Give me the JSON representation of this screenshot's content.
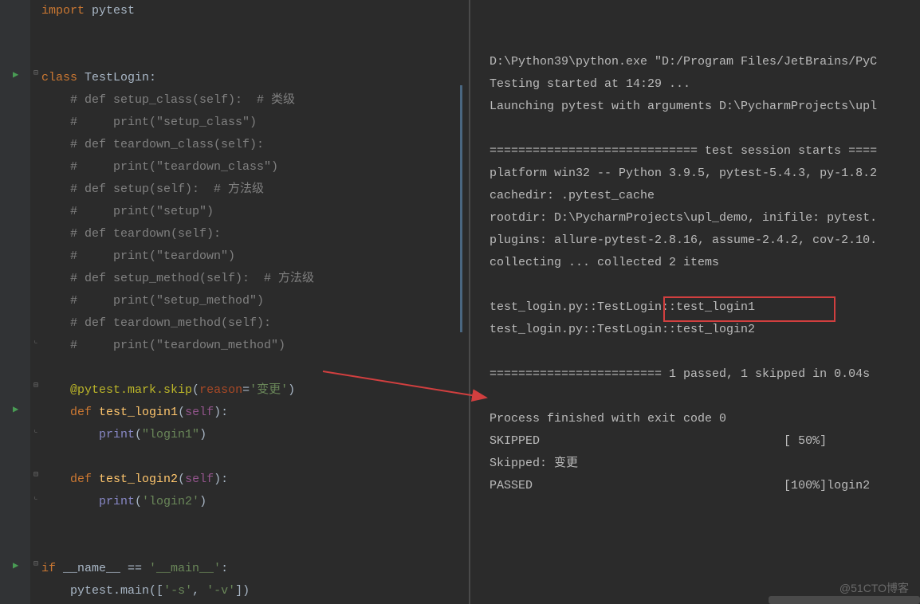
{
  "editor": {
    "lines": [
      {
        "indent": 0,
        "type": "import",
        "tokens": [
          {
            "c": "kw",
            "t": "import "
          },
          {
            "c": "",
            "t": "pytest"
          }
        ]
      },
      {
        "indent": 0,
        "type": "blank"
      },
      {
        "indent": 0,
        "type": "blank"
      },
      {
        "indent": 0,
        "type": "class",
        "run": true,
        "fold": "-",
        "tokens": [
          {
            "c": "kw",
            "t": "class "
          },
          {
            "c": "",
            "t": "TestLogin:"
          }
        ]
      },
      {
        "indent": 1,
        "type": "comment",
        "tokens": [
          {
            "c": "comment",
            "t": "# def setup_class(self):  # 类级"
          }
        ]
      },
      {
        "indent": 1,
        "type": "comment",
        "tokens": [
          {
            "c": "comment",
            "t": "#     print(\"setup_class\")"
          }
        ]
      },
      {
        "indent": 1,
        "type": "comment",
        "tokens": [
          {
            "c": "comment",
            "t": "# def teardown_class(self):"
          }
        ]
      },
      {
        "indent": 1,
        "type": "comment",
        "tokens": [
          {
            "c": "comment",
            "t": "#     print(\"teardown_class\")"
          }
        ]
      },
      {
        "indent": 1,
        "type": "comment",
        "tokens": [
          {
            "c": "comment",
            "t": "# def setup(self):  # 方法级"
          }
        ]
      },
      {
        "indent": 1,
        "type": "comment",
        "tokens": [
          {
            "c": "comment",
            "t": "#     print(\"setup\")"
          }
        ]
      },
      {
        "indent": 1,
        "type": "comment",
        "tokens": [
          {
            "c": "comment",
            "t": "# def teardown(self):"
          }
        ]
      },
      {
        "indent": 1,
        "type": "comment",
        "tokens": [
          {
            "c": "comment",
            "t": "#     print(\"teardown\")"
          }
        ]
      },
      {
        "indent": 1,
        "type": "comment",
        "tokens": [
          {
            "c": "comment",
            "t": "# def setup_method(self):  # 方法级"
          }
        ]
      },
      {
        "indent": 1,
        "type": "comment",
        "tokens": [
          {
            "c": "comment",
            "t": "#     print(\"setup_method\")"
          }
        ]
      },
      {
        "indent": 1,
        "type": "comment",
        "tokens": [
          {
            "c": "comment",
            "t": "# def teardown_method(self):"
          }
        ]
      },
      {
        "indent": 1,
        "type": "comment",
        "fold": "]",
        "tokens": [
          {
            "c": "comment",
            "t": "#     print(\"teardown_method\")"
          }
        ]
      },
      {
        "indent": 1,
        "type": "blank"
      },
      {
        "indent": 1,
        "type": "decorator",
        "fold": "-",
        "tokens": [
          {
            "c": "decorator",
            "t": "@pytest.mark.skip"
          },
          {
            "c": "",
            "t": "("
          },
          {
            "c": "paramname",
            "t": "reason"
          },
          {
            "c": "",
            "t": "="
          },
          {
            "c": "str",
            "t": "'变更'"
          },
          {
            "c": "",
            "t": ")"
          }
        ]
      },
      {
        "indent": 1,
        "type": "def",
        "run": true,
        "tokens": [
          {
            "c": "kw",
            "t": "def "
          },
          {
            "c": "fn",
            "t": "test_login1"
          },
          {
            "c": "",
            "t": "("
          },
          {
            "c": "self",
            "t": "self"
          },
          {
            "c": "",
            "t": "):"
          }
        ]
      },
      {
        "indent": 2,
        "type": "stmt",
        "fold": "]",
        "tokens": [
          {
            "c": "builtin",
            "t": "print"
          },
          {
            "c": "",
            "t": "("
          },
          {
            "c": "str",
            "t": "\"login1\""
          },
          {
            "c": "",
            "t": ")"
          }
        ]
      },
      {
        "indent": 1,
        "type": "blank"
      },
      {
        "indent": 1,
        "type": "def",
        "fold": "-",
        "tokens": [
          {
            "c": "kw",
            "t": "def "
          },
          {
            "c": "fn",
            "t": "test_login2"
          },
          {
            "c": "",
            "t": "("
          },
          {
            "c": "self",
            "t": "self"
          },
          {
            "c": "",
            "t": "):"
          }
        ]
      },
      {
        "indent": 2,
        "type": "stmt",
        "fold": "]",
        "tokens": [
          {
            "c": "builtin",
            "t": "print"
          },
          {
            "c": "",
            "t": "("
          },
          {
            "c": "str",
            "t": "'login2'"
          },
          {
            "c": "",
            "t": ")"
          }
        ]
      },
      {
        "indent": 0,
        "type": "blank"
      },
      {
        "indent": 0,
        "type": "blank"
      },
      {
        "indent": 0,
        "type": "if",
        "run": true,
        "fold": "-",
        "tokens": [
          {
            "c": "kw",
            "t": "if "
          },
          {
            "c": "",
            "t": "__name__ == "
          },
          {
            "c": "str",
            "t": "'__main__'"
          },
          {
            "c": "",
            "t": ":"
          }
        ]
      },
      {
        "indent": 1,
        "type": "stmt",
        "tokens": [
          {
            "c": "",
            "t": "pytest.main("
          },
          {
            "c": "",
            "t": "["
          },
          {
            "c": "str",
            "t": "'-s'"
          },
          {
            "c": "",
            "t": ", "
          },
          {
            "c": "str",
            "t": "'-v'"
          },
          {
            "c": "",
            "t": "]"
          },
          {
            "c": "",
            "t": ")"
          }
        ],
        "caret": true
      }
    ]
  },
  "output": {
    "lines": [
      "D:\\Python39\\python.exe \"D:/Program Files/JetBrains/PyC",
      "Testing started at 14:29 ...",
      "Launching pytest with arguments D:\\PycharmProjects\\upl",
      "",
      "============================= test session starts ====",
      "platform win32 -- Python 3.9.5, pytest-5.4.3, py-1.8.2",
      "cachedir: .pytest_cache",
      "rootdir: D:\\PycharmProjects\\upl_demo, inifile: pytest.",
      "plugins: allure-pytest-2.8.16, assume-2.4.2, cov-2.10.",
      "collecting ... collected 2 items",
      "",
      "test_login.py::TestLogin::test_login1 ",
      "test_login.py::TestLogin::test_login2 ",
      "",
      "======================== 1 passed, 1 skipped in 0.04s ",
      "",
      "Process finished with exit code 0",
      "SKIPPED                                  [ 50%]",
      "Skipped: 变更",
      "PASSED                                   [100%]login2"
    ],
    "highlight_text": "1 passed, 1 skipped"
  },
  "watermark": "@51CTO博客"
}
